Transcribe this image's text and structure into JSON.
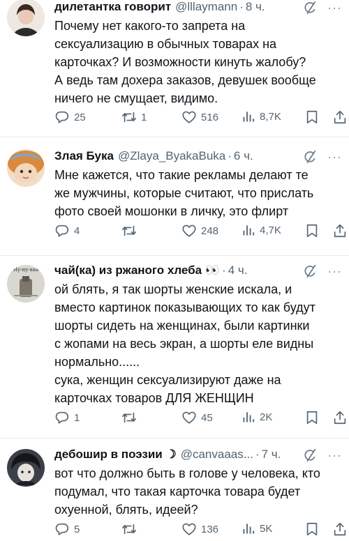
{
  "tweets": [
    {
      "name": "дилетантка говорит",
      "handle": "@lllaymann",
      "time": "8 ч.",
      "lines": [
        "Почему нет какого-то запрета на",
        "сексуализацию в обычных товарах на",
        "карточках? И возможности кинуть жалобу?",
        "А ведь там дохера заказов, девушек вообще",
        "ничего не смущает, видимо."
      ],
      "replies": "25",
      "retweets": "1",
      "likes": "516",
      "views": "8,7K"
    },
    {
      "name": "Злая Бука",
      "handle": "@Zlaya_ByakaBuka",
      "time": "6 ч.",
      "lines": [
        "Мне кажется, что такие рекламы делают те",
        "же мужчины, которые считают, что прислать",
        "фото своей мошонки в личку, это флирт"
      ],
      "replies": "4",
      "retweets": "",
      "likes": "248",
      "views": "4,7K"
    },
    {
      "name": "чай(ка) из ржаного хлеба 👀",
      "handle": "",
      "time": "4 ч.",
      "avatar_caption": "Ну-ну-ааа",
      "lines": [
        "ой блять, я так шорты женские искала, и",
        "вместо картинок показывающих то как будут",
        "шорты сидеть на женщинах, были картинки",
        "с жопами на весь экран, а шорты еле видны",
        "нормально......",
        "сука, женщин сексуализируют даже на",
        "карточках товаров ДЛЯ ЖЕНЩИН"
      ],
      "replies": "1",
      "retweets": "",
      "likes": "45",
      "views": "2K"
    },
    {
      "name": "дебошир в поэзии ☽",
      "handle": "@canvaaas...",
      "time": "7 ч.",
      "lines": [
        "вот что должно быть в голове у человека, кто",
        "подумал, что такая карточка товара будет",
        "охуенной, блять, идеей?"
      ],
      "replies": "5",
      "retweets": "",
      "likes": "136",
      "views": "5K"
    }
  ],
  "icons": {
    "reply": "reply-icon",
    "retweet": "retweet-icon",
    "like": "heart-icon",
    "views": "views-icon",
    "bookmark": "bookmark-icon",
    "share": "share-icon",
    "grok": "grok-icon",
    "more": "more-icon"
  },
  "colors": {
    "text": "#0f1419",
    "muted": "#536471",
    "divider": "#e6e9ec"
  }
}
